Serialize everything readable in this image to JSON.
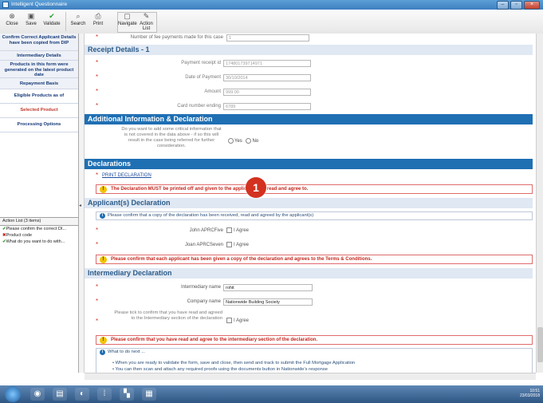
{
  "window": {
    "title": "Intelligent Questionnaire"
  },
  "toolbar": {
    "close": "Close",
    "save": "Save",
    "validate": "Validate",
    "search": "Search",
    "print": "Print",
    "navigate": "Navigate",
    "action_list": "Action List"
  },
  "sidebar": {
    "items": [
      {
        "label": "Confirm Correct Applicant Details have been copied from DIP"
      },
      {
        "label": "Intermediary Details"
      },
      {
        "label": "Products in this form were generated on the latest product date"
      },
      {
        "label": "Repayment Basis"
      },
      {
        "label": "Eligible Products as of"
      },
      {
        "label": "Selected Product"
      },
      {
        "label": "Processing Options"
      }
    ]
  },
  "action_list": {
    "header": "Action List (3 items)",
    "items": [
      {
        "label": "Please confirm the correct DI...",
        "status": "ok"
      },
      {
        "label": "Product code",
        "status": "error"
      },
      {
        "label": "What do you want to do with...",
        "status": "ok"
      }
    ]
  },
  "form": {
    "fee_payments_label": "Number of fee payments made for this case",
    "fee_payments_value": "1",
    "receipt_section": "Receipt Details - 1",
    "payment_receipt_id_label": "Payment receipt id",
    "payment_receipt_id_value": "174801739714971",
    "date_of_payment_label": "Date of Payment",
    "date_of_payment_value": "30/10/2014",
    "amount_label": "Amount",
    "amount_value": "999.00",
    "card_number_label": "Card number ending",
    "card_number_value": "6789",
    "additional_section": "Additional Information & Declaration",
    "additional_question": "Do you want to add some critical information that is not covered in the data above - if so this will result in the case being referred for further consideration.",
    "yes": "Yes",
    "no": "No",
    "declarations_section": "Declarations",
    "print_declaration": "PRINT DECLARATION",
    "declaration_warning": "The Declaration MUST be printed off and given to the applicant(s) to read and agree to.",
    "applicants_section": "Applicant(s) Declaration",
    "applicants_info": "Please confirm that a copy of the declaration has been received, read and agreed by the applicant(s)",
    "applicant1_label": "John APRCFive",
    "applicant2_label": "Joan APRCSeven",
    "i_agree": "I Agree",
    "applicants_warning": "Please confirm that each applicant has been given a copy of the declaration and agrees to the Terms & Conditions.",
    "intermediary_section": "Intermediary Declaration",
    "intermediary_name_label": "Intermediary name",
    "intermediary_name_value": "rohit",
    "company_name_label": "Company name",
    "company_name_value": "Nationwide Building Society",
    "intermediary_tick_label": "Please tick to confirm that you have read and agreed to the Intermediary section of the declaration",
    "intermediary_warning": "Please confirm that you have read and agree to the intermediary section of the declaration.",
    "next_title": "What to do next ...",
    "next_line1": "When you are ready to validate the form, save and close, then send and track to submit the Full Mortgage Application",
    "next_line2": "You can then scan and attach any required proofs using the documents button in Nationwide's response"
  },
  "badge": "1",
  "taskbar": {
    "time": "10:51",
    "date": "23/03/2018"
  }
}
